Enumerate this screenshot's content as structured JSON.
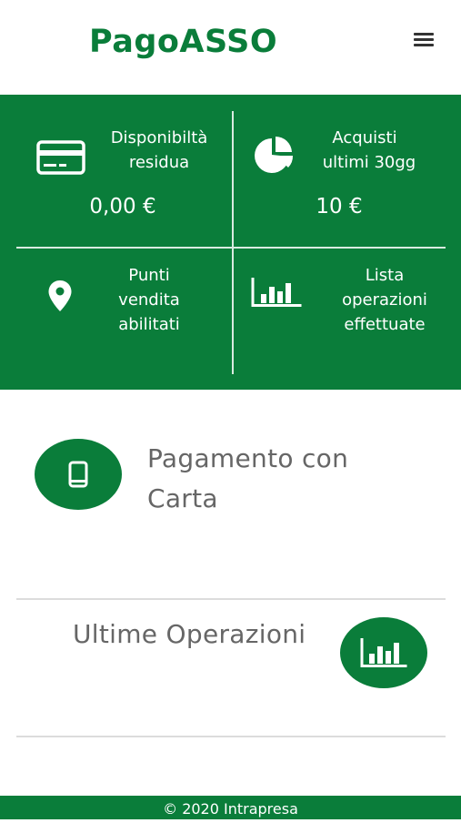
{
  "header": {
    "brand": "PagoASSO",
    "menu_icon": "hamburger-menu-icon"
  },
  "tiles": [
    {
      "label_line1": "Disponibiltà",
      "label_line2": "residua",
      "value": "0,00 €",
      "icon": "credit-card-icon"
    },
    {
      "label_line1": "Acquisti",
      "label_line2": "ultimi  30gg",
      "value": "10 €",
      "icon": "pie-chart-icon"
    },
    {
      "label_line1": "Punti",
      "label_line2": "vendita",
      "label_line3": "abilitati",
      "icon": "location-pin-icon"
    },
    {
      "label_line1": "Lista",
      "label_line2": "operazioni",
      "label_line3": "effettuate",
      "icon": "bar-chart-icon"
    }
  ],
  "payment": {
    "line1": "Pagamento con",
    "line2": "Carta",
    "icon": "smartphone-icon"
  },
  "operations": {
    "label": "Ultime Operazioni",
    "icon": "bar-chart-icon"
  },
  "footer": {
    "text": "© 2020 Intrapresa"
  },
  "colors": {
    "primary": "#0a7d3a",
    "text_gray": "#666666",
    "white": "#ffffff"
  }
}
